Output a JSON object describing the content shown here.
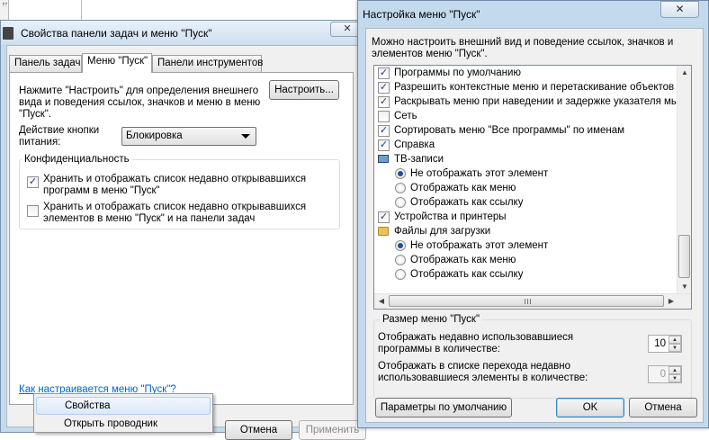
{
  "desktop": {
    "strip_text": "1:"
  },
  "taskbar_dialog": {
    "title": "Свойства панели задач и меню \"Пуск\"",
    "close_label": "✕",
    "tabs": [
      "Панель задач",
      "Меню \"Пуск\"",
      "Панели инструментов"
    ],
    "active_tab": 1,
    "instructions": [
      "Нажмите \"Настроить\" для определения внешнего",
      "вида и поведения ссылок, значков и меню в меню",
      "\"Пуск\"."
    ],
    "customize_button": "Настроить...",
    "power_label": [
      "Действие кнопки",
      "питания:"
    ],
    "power_value": "Блокировка",
    "privacy_group_title": "Конфиденциальность",
    "privacy_items": [
      {
        "lines": [
          "Хранить и отображать список недавно открывавшихся",
          "программ в меню \"Пуск\""
        ],
        "checked": true
      },
      {
        "lines": [
          "Хранить и отображать список недавно открывавшихся",
          "элементов в меню \"Пуск\" и на панели задач"
        ],
        "checked": false
      }
    ],
    "help_link": "Как настраивается меню \"Пуск\"?",
    "cancel_button": "Отмена",
    "apply_button": "Применить"
  },
  "context_menu": {
    "items": [
      "Свойства",
      "Открыть проводник"
    ],
    "highlighted": 0
  },
  "customize_dialog": {
    "title": "Настройка меню \"Пуск\"",
    "close_label": "✕",
    "description": [
      "Можно настроить внешний вид и поведение ссылок, значков и",
      "элементов меню \"Пуск\"."
    ],
    "list_items": [
      {
        "kind": "checkbox",
        "label": "Программы по умолчанию",
        "checked": true
      },
      {
        "kind": "checkbox",
        "label": "Разрешить контекстные меню и перетаскивание объектов",
        "checked": true
      },
      {
        "kind": "checkbox",
        "label": "Раскрывать меню при наведении и задержке указателя мыш",
        "checked": true
      },
      {
        "kind": "checkbox",
        "label": "Сеть",
        "checked": false
      },
      {
        "kind": "checkbox",
        "label": "Сортировать меню \"Все программы\" по именам",
        "checked": true
      },
      {
        "kind": "checkbox",
        "label": "Справка",
        "checked": true
      },
      {
        "kind": "header",
        "label": "ТВ-записи",
        "icon": "tv-icon"
      },
      {
        "kind": "radio",
        "label": "Не отображать этот элемент",
        "checked": true
      },
      {
        "kind": "radio",
        "label": "Отображать как меню",
        "checked": false
      },
      {
        "kind": "radio",
        "label": "Отображать как ссылку",
        "checked": false
      },
      {
        "kind": "checkbox",
        "label": "Устройства и принтеры",
        "checked": true
      },
      {
        "kind": "header",
        "label": "Файлы для загрузки",
        "icon": "folder-icon"
      },
      {
        "kind": "radio",
        "label": "Не отображать этот элемент",
        "checked": true
      },
      {
        "kind": "radio",
        "label": "Отображать как меню",
        "checked": false
      },
      {
        "kind": "radio",
        "label": "Отображать как ссылку",
        "checked": false
      }
    ],
    "size_group_title": "Размер меню \"Пуск\"",
    "recent_programs_label": [
      "Отображать недавно использовавшиеся",
      "программы в количестве:"
    ],
    "recent_programs_value": "10",
    "jump_list_label": [
      "Отображать в списке перехода недавно",
      "использовавшиеся элементы в количестве:"
    ],
    "jump_list_value": "0",
    "defaults_button": "Параметры по умолчанию",
    "ok_button": "OK",
    "cancel_button": "Отмена"
  }
}
